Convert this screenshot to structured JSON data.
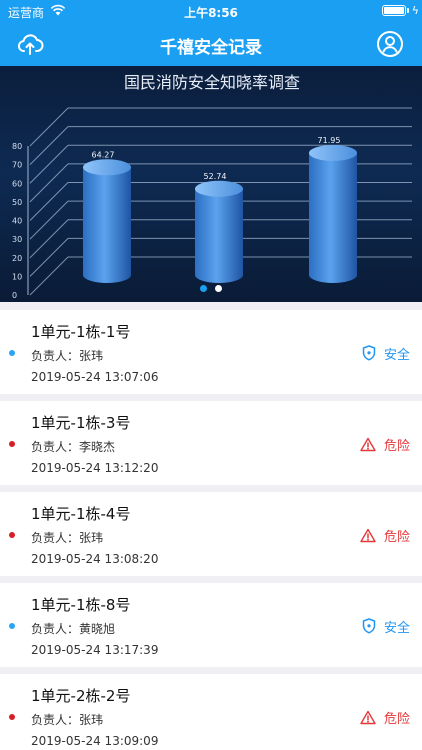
{
  "status_bar": {
    "carrier": "运营商",
    "time": "上午8:56"
  },
  "header": {
    "title": "千禧安全记录",
    "upload_icon": "cloud-upload-icon",
    "user_icon": "user-circle-icon"
  },
  "banner": {
    "slide_count": 2,
    "active_slide": 0,
    "chart_data": {
      "type": "bar",
      "title": "国民消防安全知晓率调查",
      "categories": [
        "",
        "",
        ""
      ],
      "values": [
        64.27,
        52.74,
        71.95
      ],
      "value_labels": [
        "64.27",
        "52.74",
        "71.95"
      ],
      "y_ticks": [
        "0",
        "10",
        "20",
        "30",
        "40",
        "50",
        "60",
        "70",
        "80"
      ],
      "ylim": [
        0,
        80
      ],
      "grid": true
    }
  },
  "colors": {
    "brand": "#1b9ff3",
    "safe": "#2196f3",
    "danger": "#e5383b",
    "safe_dot": "#2aa6f5",
    "danger_dot": "#d61f26"
  },
  "records": [
    {
      "name": "1单元-1栋-1号",
      "person_label": "负责人：",
      "person": "张玮",
      "time": "2019-05-24 13:07:06",
      "status": "安全",
      "status_type": "safe",
      "status_icon": "shield-icon"
    },
    {
      "name": "1单元-1栋-3号",
      "person_label": "负责人：",
      "person": "李晓杰",
      "time": "2019-05-24 13:12:20",
      "status": "危险",
      "status_type": "danger",
      "status_icon": "warning-icon"
    },
    {
      "name": "1单元-1栋-4号",
      "person_label": "负责人：",
      "person": "张玮",
      "time": "2019-05-24 13:08:20",
      "status": "危险",
      "status_type": "danger",
      "status_icon": "warning-icon"
    },
    {
      "name": "1单元-1栋-8号",
      "person_label": "负责人：",
      "person": "黄晓旭",
      "time": "2019-05-24 13:17:39",
      "status": "安全",
      "status_type": "safe",
      "status_icon": "shield-icon"
    },
    {
      "name": "1单元-2栋-2号",
      "person_label": "负责人：",
      "person": "张玮",
      "time": "2019-05-24 13:09:09",
      "status": "危险",
      "status_type": "danger",
      "status_icon": "warning-icon"
    }
  ]
}
